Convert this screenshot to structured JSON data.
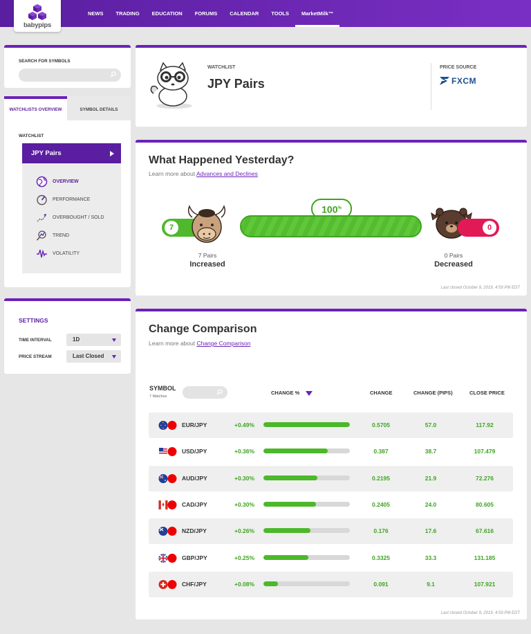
{
  "brand": {
    "name": "babypips",
    "color": "#6a22b8"
  },
  "nav": [
    {
      "label": "NEWS"
    },
    {
      "label": "TRADING"
    },
    {
      "label": "EDUCATION"
    },
    {
      "label": "FORUMS"
    },
    {
      "label": "CALENDAR"
    },
    {
      "label": "TOOLS"
    },
    {
      "label": "MarketMilk™",
      "active": true
    }
  ],
  "sidebar": {
    "search_label": "SEARCH FOR SYMBOLS",
    "tabs": [
      {
        "label": "WATCHLISTS OVERVIEW"
      },
      {
        "label": "SYMBOL DETAILS"
      }
    ],
    "watchlist_label": "WATCHLIST",
    "watchlist_selected": "JPY Pairs",
    "menu": [
      {
        "label": "OVERVIEW",
        "icon": "globe-icon",
        "active": true
      },
      {
        "label": "PERFORMANCE",
        "icon": "gauge-icon"
      },
      {
        "label": "OVERBOUGHT / SOLD",
        "icon": "trend-arrow-icon"
      },
      {
        "label": "TREND",
        "icon": "trend-magnifier-icon"
      },
      {
        "label": "VOLATILITY",
        "icon": "pulse-icon"
      }
    ],
    "settings": {
      "title": "SETTINGS",
      "time_interval_label": "TIME INTERVAL",
      "time_interval_value": "1D",
      "price_stream_label": "PRICE STREAM",
      "price_stream_value": "Last Closed"
    }
  },
  "header": {
    "watchlist_label": "WATCHLIST",
    "title": "JPY Pairs",
    "price_source_label": "PRICE SOURCE",
    "price_source": "FXCM"
  },
  "what_happened": {
    "title": "What Happened Yesterday?",
    "learn_prefix": "Learn more about ",
    "learn_link": "Advances and Declines",
    "increased_count": "7",
    "decreased_count": "0",
    "percent": "100",
    "percent_sign": "%",
    "increased_pairs": "7 Pairs",
    "increased_label": "Increased",
    "decreased_pairs": "0 Pairs",
    "decreased_label": "Decreased",
    "last_closed": "Last closed October 9, 2019, 4:59 PM EDT"
  },
  "comparison": {
    "title": "Change Comparison",
    "learn_prefix": "Learn more about ",
    "learn_link": "Change Comparison",
    "symbol_header": "SYMBOL",
    "matches": "7 Matches",
    "headers": {
      "change_pct": "CHANGE %",
      "change": "CHANGE",
      "pips": "CHANGE (PIPS)",
      "close": "CLOSE PRICE"
    },
    "rows": [
      {
        "pair": "EUR/JPY",
        "pct": "+0.49%",
        "bar": 1.0,
        "change": "0.5705",
        "pips": "57.0",
        "close": "117.92",
        "flag": "eu"
      },
      {
        "pair": "USD/JPY",
        "pct": "+0.36%",
        "bar": 0.74,
        "change": "0.387",
        "pips": "38.7",
        "close": "107.479",
        "flag": "us"
      },
      {
        "pair": "AUD/JPY",
        "pct": "+0.30%",
        "bar": 0.62,
        "change": "0.2195",
        "pips": "21.9",
        "close": "72.276",
        "flag": "au"
      },
      {
        "pair": "CAD/JPY",
        "pct": "+0.30%",
        "bar": 0.61,
        "change": "0.2405",
        "pips": "24.0",
        "close": "80.605",
        "flag": "ca"
      },
      {
        "pair": "NZD/JPY",
        "pct": "+0.26%",
        "bar": 0.54,
        "change": "0.176",
        "pips": "17.6",
        "close": "67.616",
        "flag": "nz"
      },
      {
        "pair": "GBP/JPY",
        "pct": "+0.25%",
        "bar": 0.52,
        "change": "0.3325",
        "pips": "33.3",
        "close": "131.185",
        "flag": "gb"
      },
      {
        "pair": "CHF/JPY",
        "pct": "+0.08%",
        "bar": 0.17,
        "change": "0.091",
        "pips": "9.1",
        "close": "107.921",
        "flag": "ch"
      }
    ],
    "last_closed": "Last closed October 9, 2019, 4:59 PM EDT"
  }
}
